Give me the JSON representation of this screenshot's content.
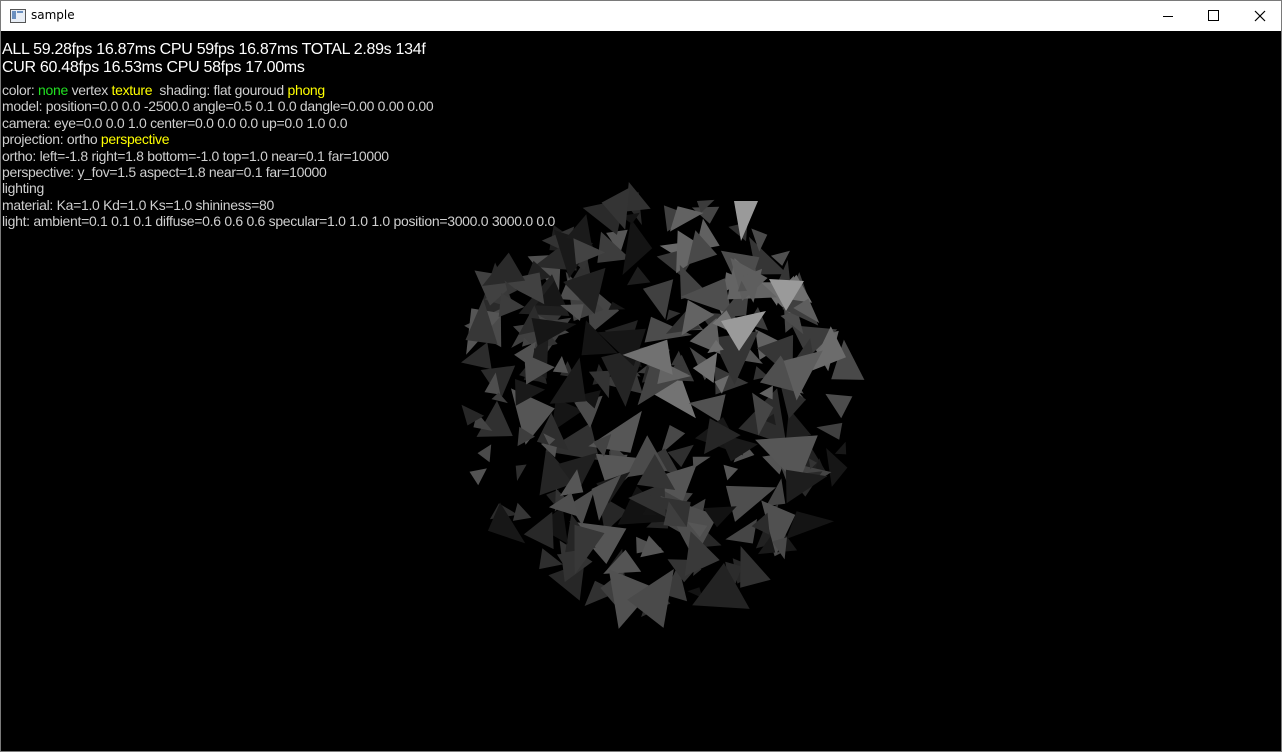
{
  "window": {
    "title": "sample",
    "icon": "app-window-icon",
    "controls": [
      "minimize-icon",
      "maximize-icon",
      "close-icon"
    ]
  },
  "stats": {
    "all": "ALL  59.28fps 16.87ms CPU 59fps 16.87ms TOTAL 2.89s 134f",
    "cur": "CUR 60.48fps 16.53ms CPU 58fps 17.00ms"
  },
  "color_line": {
    "label": "color:",
    "none": "none",
    "vertex": "vertex",
    "texture": "texture",
    "shading_label": "shading:",
    "flat": "flat",
    "gouroud": "gouroud",
    "phong": "phong"
  },
  "model_line": "model: position=0.0 0.0 -2500.0 angle=0.5 0.1 0.0 dangle=0.00 0.00 0.00",
  "camera_line": "camera: eye=0.0 0.0 1.0 center=0.0 0.0 0.0 up=0.0 1.0 0.0",
  "projection_line": {
    "label": "projection:",
    "ortho": "ortho",
    "perspective": "perspective"
  },
  "ortho_line": "ortho: left=-1.8 right=1.8 bottom=-1.0 top=1.0 near=0.1 far=10000",
  "perspective_line": "perspective: y_fov=1.5 aspect=1.8 near=0.1 far=10000",
  "lighting_line": "lighting",
  "material_line": "material: Ka=1.0 Kd=1.0 Ks=1.0 shininess=80",
  "light_line": "light: ambient=0.1 0.1 0.1 diffuse=0.6 0.6 0.6 specular=1.0 1.0 1.0 position=3000.0 3000.0 0.0",
  "colors": {
    "background": "#000000",
    "hud_text": "#cfcfcf",
    "highlight_green": "#22e022",
    "highlight_yellow": "#ffff00"
  }
}
